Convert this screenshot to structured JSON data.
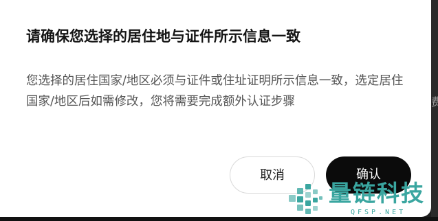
{
  "dialog": {
    "title": "请确保您选择的居住地与证件所示信息一致",
    "body": "您选择的居住国家/地区必须与证件或住址证明所示信息一致，选定居住国家/地区后如需修改，您将需要完成额外认证步骤",
    "cancel_label": "取消",
    "confirm_label": "确认"
  },
  "background": {
    "partial_glyph": "费"
  },
  "watermark": {
    "brand": "量链科技",
    "domain": "QFSP.NET"
  },
  "colors": {
    "primary_button": "#0b0b0b",
    "watermark": "#3aa6a0",
    "title_text": "#141414",
    "body_text": "#555555"
  }
}
